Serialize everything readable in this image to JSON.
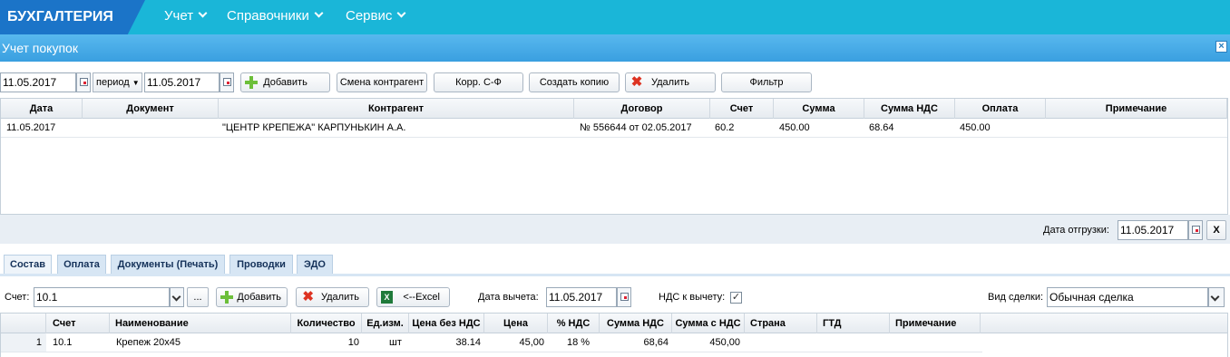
{
  "app": {
    "brand": "БУХГАЛТЕРИЯ"
  },
  "menu": [
    {
      "label": "Учет"
    },
    {
      "label": "Справочники"
    },
    {
      "label": "Сервис"
    }
  ],
  "window": {
    "title": "Учет покупок",
    "close": "×"
  },
  "toolbar": {
    "date_from": "11.05.2017",
    "period_label": "период",
    "date_to": "11.05.2017",
    "add": "Добавить",
    "change_counterparty": "Смена контрагент",
    "corr_invoice": "Корр. С-Ф",
    "create_copy": "Создать копию",
    "delete": "Удалить",
    "filter": "Фильтр"
  },
  "purchases": {
    "columns": [
      "Дата",
      "Документ",
      "Контрагент",
      "Договор",
      "Счет",
      "Сумма",
      "Сумма НДС",
      "Оплата",
      "Примечание"
    ],
    "rows": [
      {
        "date": "11.05.2017",
        "doc": "",
        "counterparty": "\"ЦЕНТР КРЕПЕЖА\" КАРПУНЬКИН А.А.",
        "contract": "№ 556644 от 02.05.2017",
        "account": "60.2",
        "sum": "450.00",
        "vat": "68.64",
        "payment": "450.00",
        "note": ""
      }
    ]
  },
  "shipment": {
    "label": "Дата отгрузки:",
    "date": "11.05.2017",
    "clear": "X"
  },
  "tabs": [
    "Состав",
    "Оплата",
    "Документы (Печать)",
    "Проводки",
    "ЭДО"
  ],
  "detail_toolbar": {
    "account_label": "Счет:",
    "account_value": "10.1",
    "dots": "...",
    "add": "Добавить",
    "delete": "Удалить",
    "excel": "<--Excel",
    "deduct_date_label": "Дата вычета:",
    "deduct_date": "11.05.2017",
    "vat_deduct_label": "НДС к вычету:",
    "vat_deduct_checked": "✓",
    "deal_type_label": "Вид сделки:",
    "deal_type": "Обычная сделка"
  },
  "items": {
    "columns": [
      "",
      "Счет",
      "Наименование",
      "Количество",
      "Ед.изм.",
      "Цена без НДС",
      "Цена",
      "% НДС",
      "Сумма НДС",
      "Сумма с НДС",
      "Страна",
      "ГТД",
      "Примечание"
    ],
    "rows": [
      {
        "n": "1",
        "account": "10.1",
        "name": "Крепеж 20х45",
        "qty": "10",
        "unit": "шт",
        "price_novat": "38.14",
        "price": "45,00",
        "vat_pct": "18 %",
        "vat_sum": "68,64",
        "total": "450,00",
        "country": "",
        "gtd": "",
        "note": ""
      }
    ]
  }
}
